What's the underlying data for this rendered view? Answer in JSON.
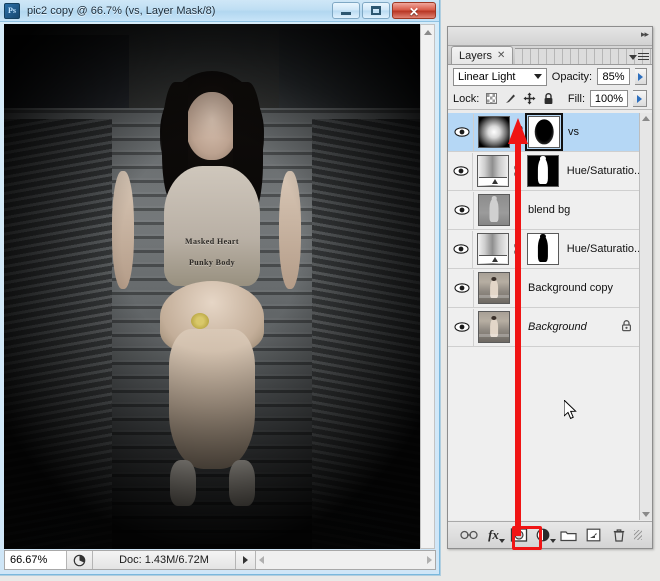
{
  "document_window": {
    "title": "pic2 copy @ 66.7% (vs, Layer Mask/8)",
    "app_icon": "photoshop-icon",
    "window_buttons": {
      "minimize": "minimize-icon",
      "maximize": "maximize-icon",
      "close": "✕"
    },
    "photo": {
      "shirt_text_line1": "Masked Heart",
      "shirt_text_line2": "Punky Body"
    },
    "status_bar": {
      "zoom": "66.67%",
      "doc_info": "Doc: 1.43M/6.72M"
    }
  },
  "layers_panel": {
    "tab_label": "Layers",
    "tab_close": "✕",
    "blend_mode": "Linear Light",
    "opacity_label": "Opacity:",
    "opacity_value": "85%",
    "lock_label": "Lock:",
    "fill_label": "Fill:",
    "fill_value": "100%",
    "lock_icons": [
      "lock-transparency-icon",
      "lock-image-icon",
      "lock-position-icon",
      "lock-all-icon"
    ],
    "layers": [
      {
        "name": "vs",
        "selected": true,
        "visible": true,
        "thumb": "radial-gradient-thumbnail",
        "linked": true,
        "mask": "black-oval-mask",
        "mask_selected": true,
        "locked": false,
        "italic": false
      },
      {
        "name": "Hue/Saturatio...",
        "selected": false,
        "visible": true,
        "thumb": "gradient-map-thumbnail",
        "linked": true,
        "mask": "white-silhouette-mask",
        "mask_selected": false,
        "locked": false,
        "italic": false
      },
      {
        "name": "blend bg",
        "selected": false,
        "visible": true,
        "thumb": "gray-person-thumbnail",
        "linked": false,
        "mask": null,
        "mask_selected": false,
        "locked": false,
        "italic": false
      },
      {
        "name": "Hue/Saturatio...",
        "selected": false,
        "visible": true,
        "thumb": "gradient-map-thumbnail",
        "linked": true,
        "mask": "black-silhouette-mask",
        "mask_selected": false,
        "locked": false,
        "italic": false
      },
      {
        "name": "Background copy",
        "selected": false,
        "visible": true,
        "thumb": "photo-thumbnail",
        "linked": false,
        "mask": null,
        "mask_selected": false,
        "locked": false,
        "italic": false
      },
      {
        "name": "Background",
        "selected": false,
        "visible": true,
        "thumb": "photo-thumbnail",
        "linked": false,
        "mask": null,
        "mask_selected": false,
        "locked": true,
        "italic": true
      }
    ],
    "bottom_toolbar": [
      {
        "name": "link-layers-icon",
        "label": ""
      },
      {
        "name": "layer-style-fx-icon",
        "label": "fx"
      },
      {
        "name": "add-layer-mask-icon",
        "label": "",
        "highlighted": true
      },
      {
        "name": "new-adjustment-layer-icon",
        "label": ""
      },
      {
        "name": "new-group-icon",
        "label": ""
      },
      {
        "name": "new-layer-icon",
        "label": ""
      },
      {
        "name": "delete-layer-icon",
        "label": ""
      }
    ]
  },
  "annotation": {
    "arrow_color": "#f01414",
    "highlight_color": "#f01414"
  }
}
